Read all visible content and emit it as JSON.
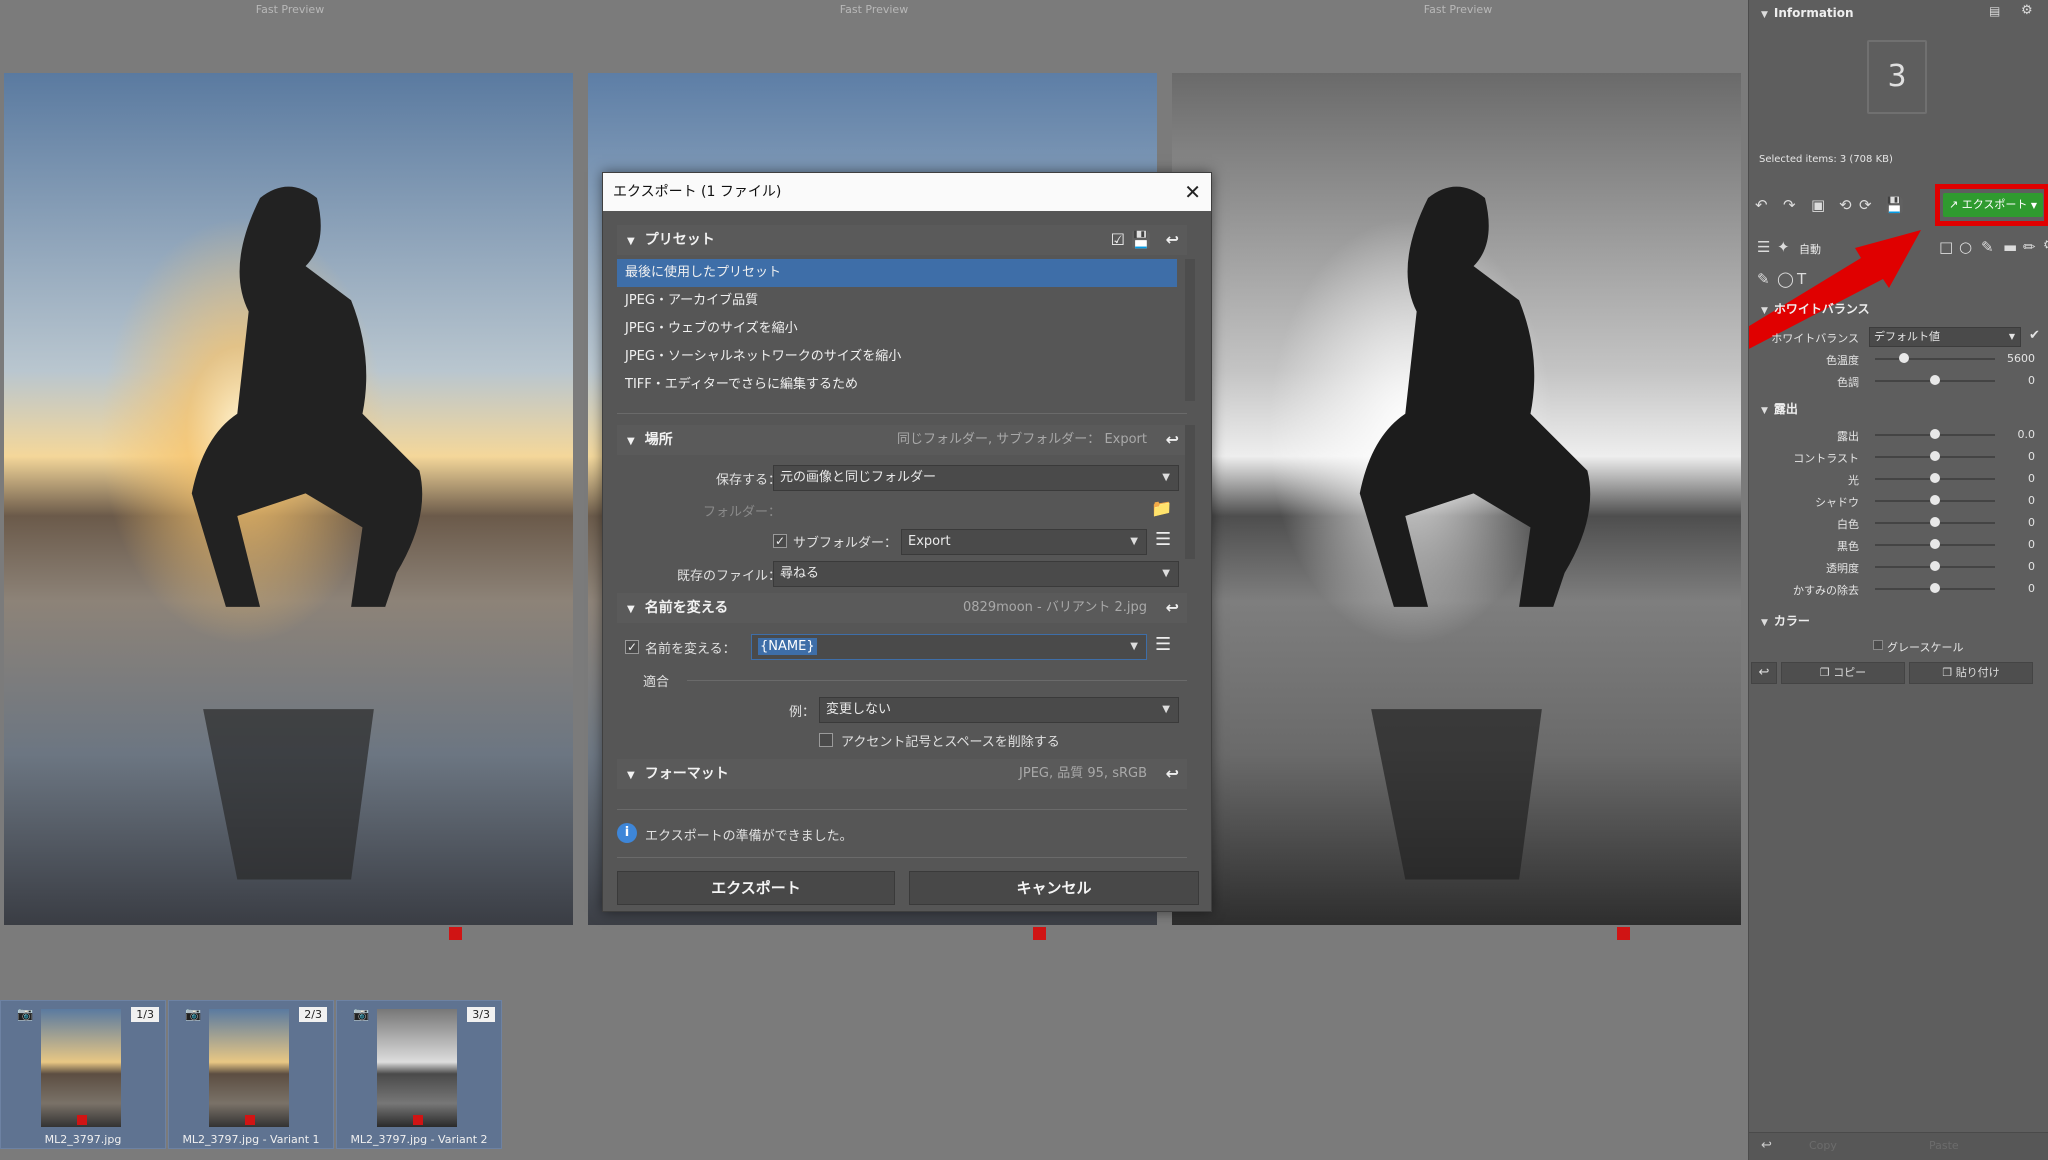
{
  "viewer": {
    "fast_preview_label": "Fast Preview"
  },
  "filmstrip": [
    {
      "counter": "1/3",
      "caption": "ML2_3797.jpg"
    },
    {
      "counter": "2/3",
      "caption": "ML2_3797.jpg - Variant 1"
    },
    {
      "counter": "3/3",
      "caption": "ML2_3797.jpg - Variant 2"
    }
  ],
  "panel": {
    "info_title": "Information",
    "count": "3",
    "selected_items": "Selected items: 3 (708 KB)",
    "export_button": "エクスポート",
    "auto_label": "自動",
    "wb_section": "ホワイトバランス",
    "wb_label": "ホワイトバランス",
    "wb_value": "デフォルト値",
    "wb_sliders": [
      {
        "label": "色温度",
        "value": "5600",
        "pos": 0.24
      },
      {
        "label": "色調",
        "value": "0",
        "pos": 0.5
      }
    ],
    "exposure_section": "露出",
    "exposure_sliders": [
      {
        "label": "露出",
        "value": "0.0",
        "pos": 0.5
      },
      {
        "label": "コントラスト",
        "value": "0",
        "pos": 0.5
      },
      {
        "label": "光",
        "value": "0",
        "pos": 0.5
      },
      {
        "label": "シャドウ",
        "value": "0",
        "pos": 0.5
      },
      {
        "label": "白色",
        "value": "0",
        "pos": 0.5
      },
      {
        "label": "黒色",
        "value": "0",
        "pos": 0.5
      },
      {
        "label": "透明度",
        "value": "0",
        "pos": 0.5
      },
      {
        "label": "かすみの除去",
        "value": "0",
        "pos": 0.5
      }
    ],
    "color_section": "カラー",
    "grayscale_label": "グレースケール",
    "copy_label": "コピー",
    "paste_label": "貼り付け",
    "bottom_copy": "Copy",
    "bottom_paste": "Paste"
  },
  "dialog": {
    "title": "エクスポート (1 ファイル)",
    "preset_section": "プリセット",
    "presets": [
      "最後に使用したプリセット",
      "JPEG・アーカイブ品質",
      "JPEG・ウェブのサイズを縮小",
      "JPEG・ソーシャルネットワークのサイズを縮小",
      "TIFF・エディターでさらに編集するため"
    ],
    "location_section": "場所",
    "location_summary": "同じフォルダー, サブフォルダー： Export",
    "save_label": "保存する：",
    "save_value": "元の画像と同じフォルダー",
    "folder_label": "フォルダー：",
    "subfolder_label": "サブフォルダー：",
    "subfolder_value": "Export",
    "existing_label": "既存のファイル：",
    "existing_value": "尋ねる",
    "rename_section": "名前を変える",
    "rename_summary": "0829moon - バリアント 2.jpg",
    "rename_label": "名前を変える：",
    "rename_value": "{NAME}",
    "apply_label": "適合",
    "example_label": "例：",
    "example_value": "変更しない",
    "remove_accents_label": "アクセント記号とスペースを削除する",
    "format_section": "フォーマット",
    "format_summary": "JPEG, 品質 95, sRGB",
    "status_text": "エクスポートの準備ができました。",
    "export_button": "エクスポート",
    "cancel_button": "キャンセル"
  },
  "colors": {
    "accent_blue": "#3e6ea8",
    "export_green": "#2f9b2f",
    "highlight_red": "#e00000"
  }
}
